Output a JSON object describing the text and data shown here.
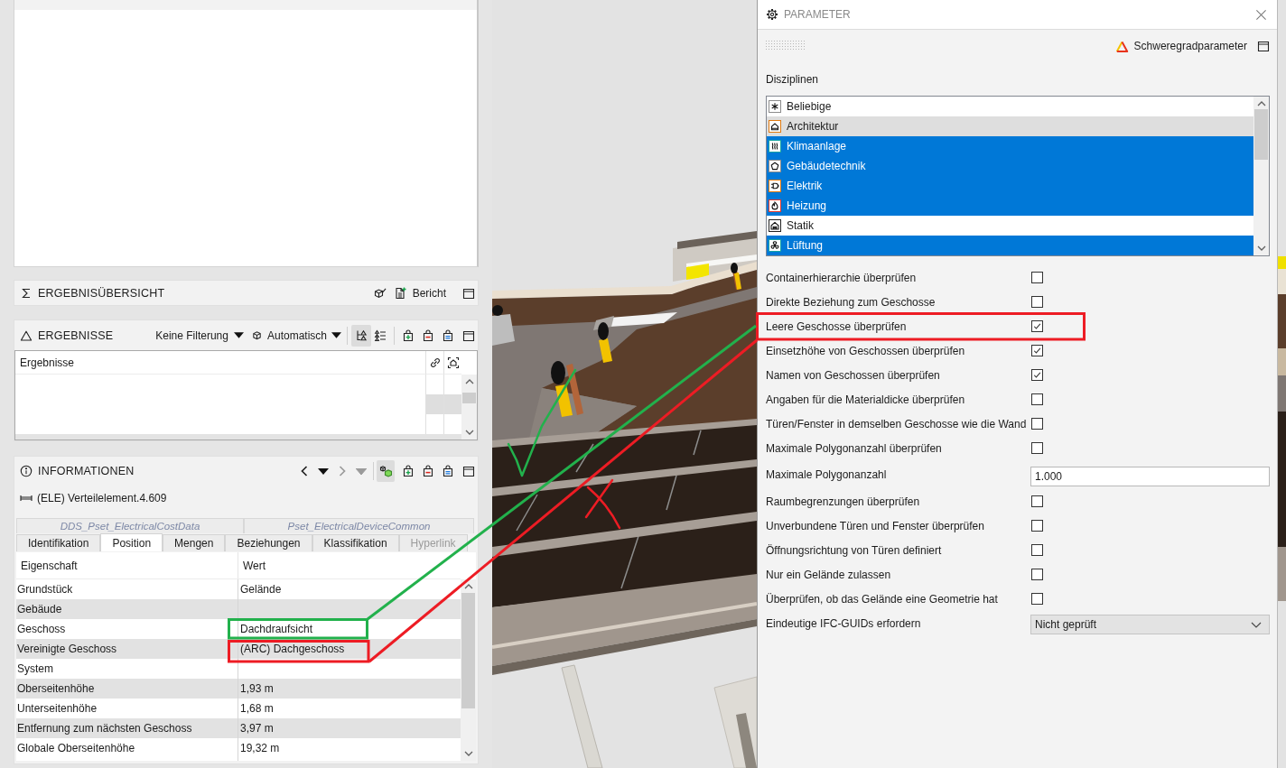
{
  "results_overview": {
    "title": "ERGEBNISÜBERSICHT",
    "report_button": "Bericht"
  },
  "results": {
    "title": "ERGEBNISSE",
    "filter": "Keine Filterung",
    "mode": "Automatisch",
    "view_toggle": [
      {
        "selected": true
      },
      {
        "selected": false
      }
    ],
    "table": {
      "columns": [
        "Ergebnisse"
      ]
    }
  },
  "information": {
    "title": "INFORMATIONEN",
    "nav_buttons": [
      {
        "kind": "back",
        "disabled": false
      },
      {
        "kind": "menu",
        "disabled": false
      },
      {
        "kind": "forward",
        "disabled": true
      },
      {
        "kind": "menu",
        "disabled": true
      }
    ],
    "model_toggle": {
      "on": true
    },
    "element": "(ELE) Verteilelement.4.609",
    "property_set_tabs": [
      {
        "label": "DDS_Pset_ElectricalCostData",
        "selected": false
      },
      {
        "label": "Pset_ElectricalDeviceCommon",
        "selected": false
      }
    ],
    "tabs": [
      {
        "label": "Identifikation",
        "selected": false,
        "disabled": false
      },
      {
        "label": "Position",
        "selected": true,
        "disabled": false
      },
      {
        "label": "Mengen",
        "selected": false,
        "disabled": false
      },
      {
        "label": "Beziehungen",
        "selected": false,
        "disabled": false
      },
      {
        "label": "Klassifikation",
        "selected": false,
        "disabled": false
      },
      {
        "label": "Hyperlink",
        "selected": false,
        "disabled": true
      }
    ],
    "table": {
      "columns": [
        "Eigenschaft",
        "Wert"
      ],
      "rows": [
        {
          "property": "Grundstück",
          "value": "Gelände"
        },
        {
          "property": "Gebäude"
        },
        {
          "property": "Geschoss",
          "value": "Dachdraufsicht"
        },
        {
          "property": "Vereinigte Geschoss",
          "value": "(ARC) Dachgeschoss"
        },
        {
          "property": "System"
        },
        {
          "property": "Oberseitenhöhe",
          "value": "1,93 m"
        },
        {
          "property": "Unterseitenhöhe",
          "value": "1,68 m"
        },
        {
          "property": "Entfernung zum nächsten Geschoss",
          "value": "3,97 m"
        },
        {
          "property": "Globale Oberseitenhöhe",
          "value": "19,32 m"
        }
      ]
    }
  },
  "parameter_panel": {
    "title": "PARAMETER",
    "severity_button": "Schweregradparameter",
    "disciplines_label": "Disziplinen",
    "disciplines": [
      {
        "label": "Beliebige",
        "selected": false,
        "hovered": false
      },
      {
        "label": "Architektur",
        "selected": false,
        "hovered": true
      },
      {
        "label": "Klimaanlage",
        "selected": true,
        "hovered": false
      },
      {
        "label": "Gebäudetechnik",
        "selected": true,
        "hovered": false
      },
      {
        "label": "Elektrik",
        "selected": true,
        "hovered": false
      },
      {
        "label": "Heizung",
        "selected": true,
        "hovered": false
      },
      {
        "label": "Statik",
        "selected": false,
        "hovered": false
      },
      {
        "label": "Lüftung",
        "selected": true,
        "hovered": false
      }
    ],
    "options": [
      {
        "kind": "checkbox",
        "label": "Containerhierarchie überprüfen",
        "checked": false
      },
      {
        "kind": "checkbox",
        "label": "Direkte Beziehung zum Geschosse",
        "checked": false
      },
      {
        "kind": "checkbox",
        "label": "Leere Geschosse überprüfen",
        "checked": true
      },
      {
        "kind": "checkbox",
        "label": "Einsetzhöhe von Geschossen überprüfen",
        "checked": true
      },
      {
        "kind": "checkbox",
        "label": "Namen von Geschossen überprüfen",
        "checked": true
      },
      {
        "kind": "checkbox",
        "label": "Angaben für die Materialdicke überprüfen",
        "checked": false
      },
      {
        "kind": "checkbox",
        "label": "Türen/Fenster in demselben Geschosse wie die Wand",
        "checked": false
      },
      {
        "kind": "checkbox",
        "label": "Maximale Polygonanzahl überprüfen",
        "checked": false
      },
      {
        "kind": "number",
        "label": "Maximale Polygonanzahl",
        "value": "1.000"
      },
      {
        "kind": "checkbox",
        "label": "Raumbegrenzungen überprüfen",
        "checked": false
      },
      {
        "kind": "checkbox",
        "label": "Unverbundene Türen und Fenster überprüfen",
        "checked": false
      },
      {
        "kind": "checkbox",
        "label": "Öffnungsrichtung von Türen definiert",
        "checked": false
      },
      {
        "kind": "checkbox",
        "label": "Nur ein Gelände zulassen",
        "checked": false
      },
      {
        "kind": "checkbox",
        "label": "Überprüfen, ob das Gelände eine Geometrie hat",
        "checked": false
      },
      {
        "kind": "select",
        "label": "Eindeutige IFC-GUIDs erfordern",
        "value": "Nicht geprüft"
      }
    ]
  }
}
